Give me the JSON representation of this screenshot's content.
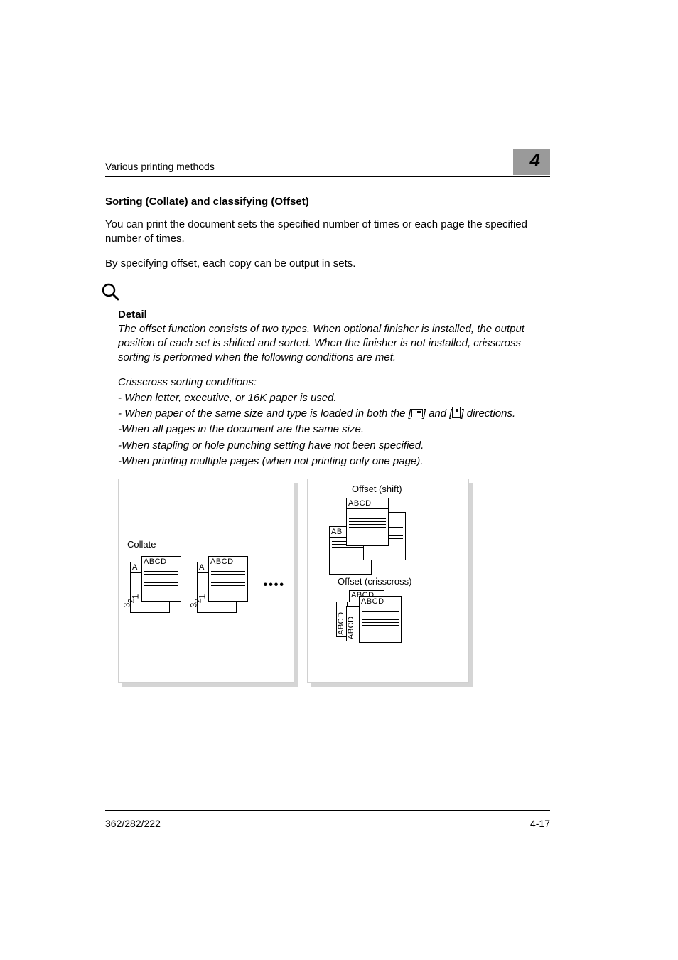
{
  "header": {
    "running_head": "Various printing methods",
    "chapter_number": "4"
  },
  "section": {
    "heading": "Sorting (Collate) and classifying (Offset)",
    "para1": "You can print the document sets the specified number of times or each page the specified number of times.",
    "para2": "By specifying offset, each copy can be output in sets."
  },
  "detail": {
    "label": "Detail",
    "para1": "The offset function consists of two types. When optional finisher is installed, the output position of each set is shifted and sorted. When the finisher is not installed, crisscross sorting is performed when the following conditions are met.",
    "cond_intro": "Crisscross sorting conditions:",
    "cond1": "- When letter, executive, or 16K paper is used.",
    "cond2a": "- When paper of the same size and type is loaded in both the [",
    "cond2b": "] and [",
    "cond2c": "] directions.",
    "cond3": "-When all pages in the document are the same size.",
    "cond4": "-When stapling or hole punching setting have not been specified.",
    "cond5": "-When printing multiple pages (when not printing only one page)."
  },
  "diagram": {
    "collate_label": "Collate",
    "offset_shift_label": "Offset (shift)",
    "offset_criss_label": "Offset (crisscross)",
    "sheet_text": "ABCD"
  },
  "footer": {
    "model": "362/282/222",
    "page": "4-17"
  }
}
